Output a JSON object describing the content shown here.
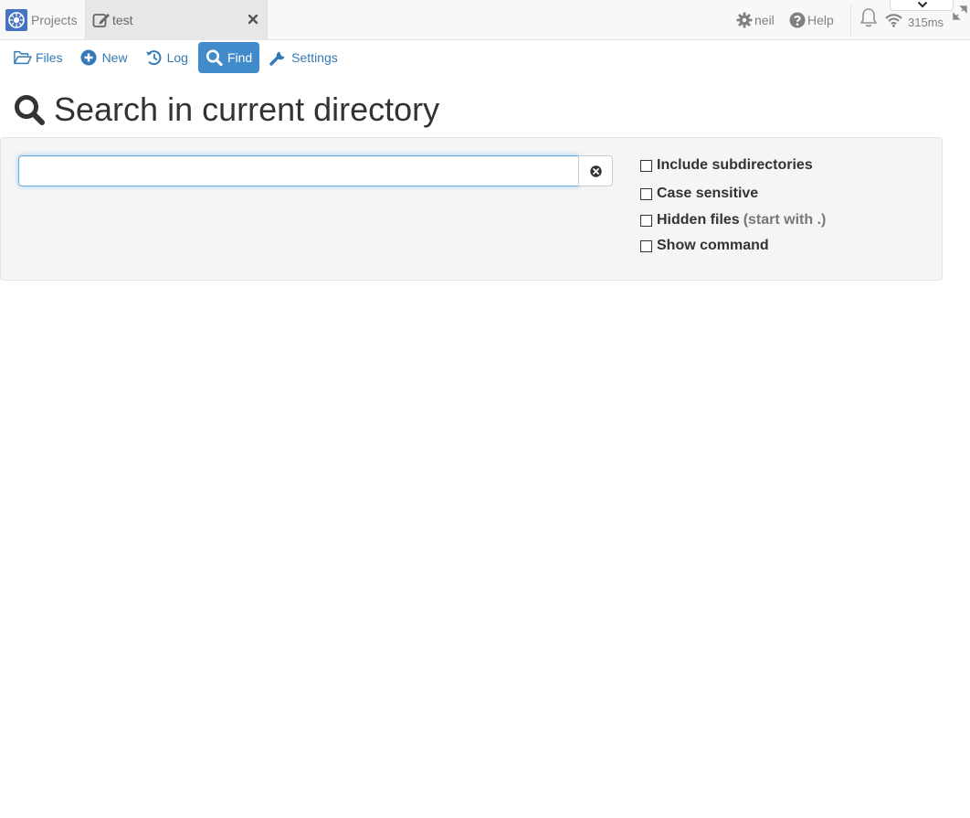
{
  "topbar": {
    "projects_label": "Projects",
    "tab_label": "test",
    "user_label": "neil",
    "help_label": "Help",
    "ping_label": "315ms"
  },
  "nav": {
    "items": [
      {
        "label": "Files",
        "icon": "folder-open-icon",
        "active": false
      },
      {
        "label": "New",
        "icon": "plus-circle-icon",
        "active": false
      },
      {
        "label": "Log",
        "icon": "history-icon",
        "active": false
      },
      {
        "label": "Find",
        "icon": "search-icon",
        "active": true
      },
      {
        "label": "Settings",
        "icon": "wrench-icon",
        "active": false
      }
    ]
  },
  "page": {
    "title": "Search in current directory"
  },
  "search": {
    "value": "",
    "placeholder": ""
  },
  "options": {
    "subdirs_label": "Include subdirectories",
    "case_label": "Case sensitive",
    "hidden_label": "Hidden files",
    "hidden_hint": "(start with .)",
    "command_label": "Show command"
  },
  "colors": {
    "accent": "#428bca",
    "link": "#337ab7",
    "well_bg": "#f5f5f5",
    "topbar_bg": "#f8f8f8",
    "tab_bg": "#e7e7e7"
  }
}
